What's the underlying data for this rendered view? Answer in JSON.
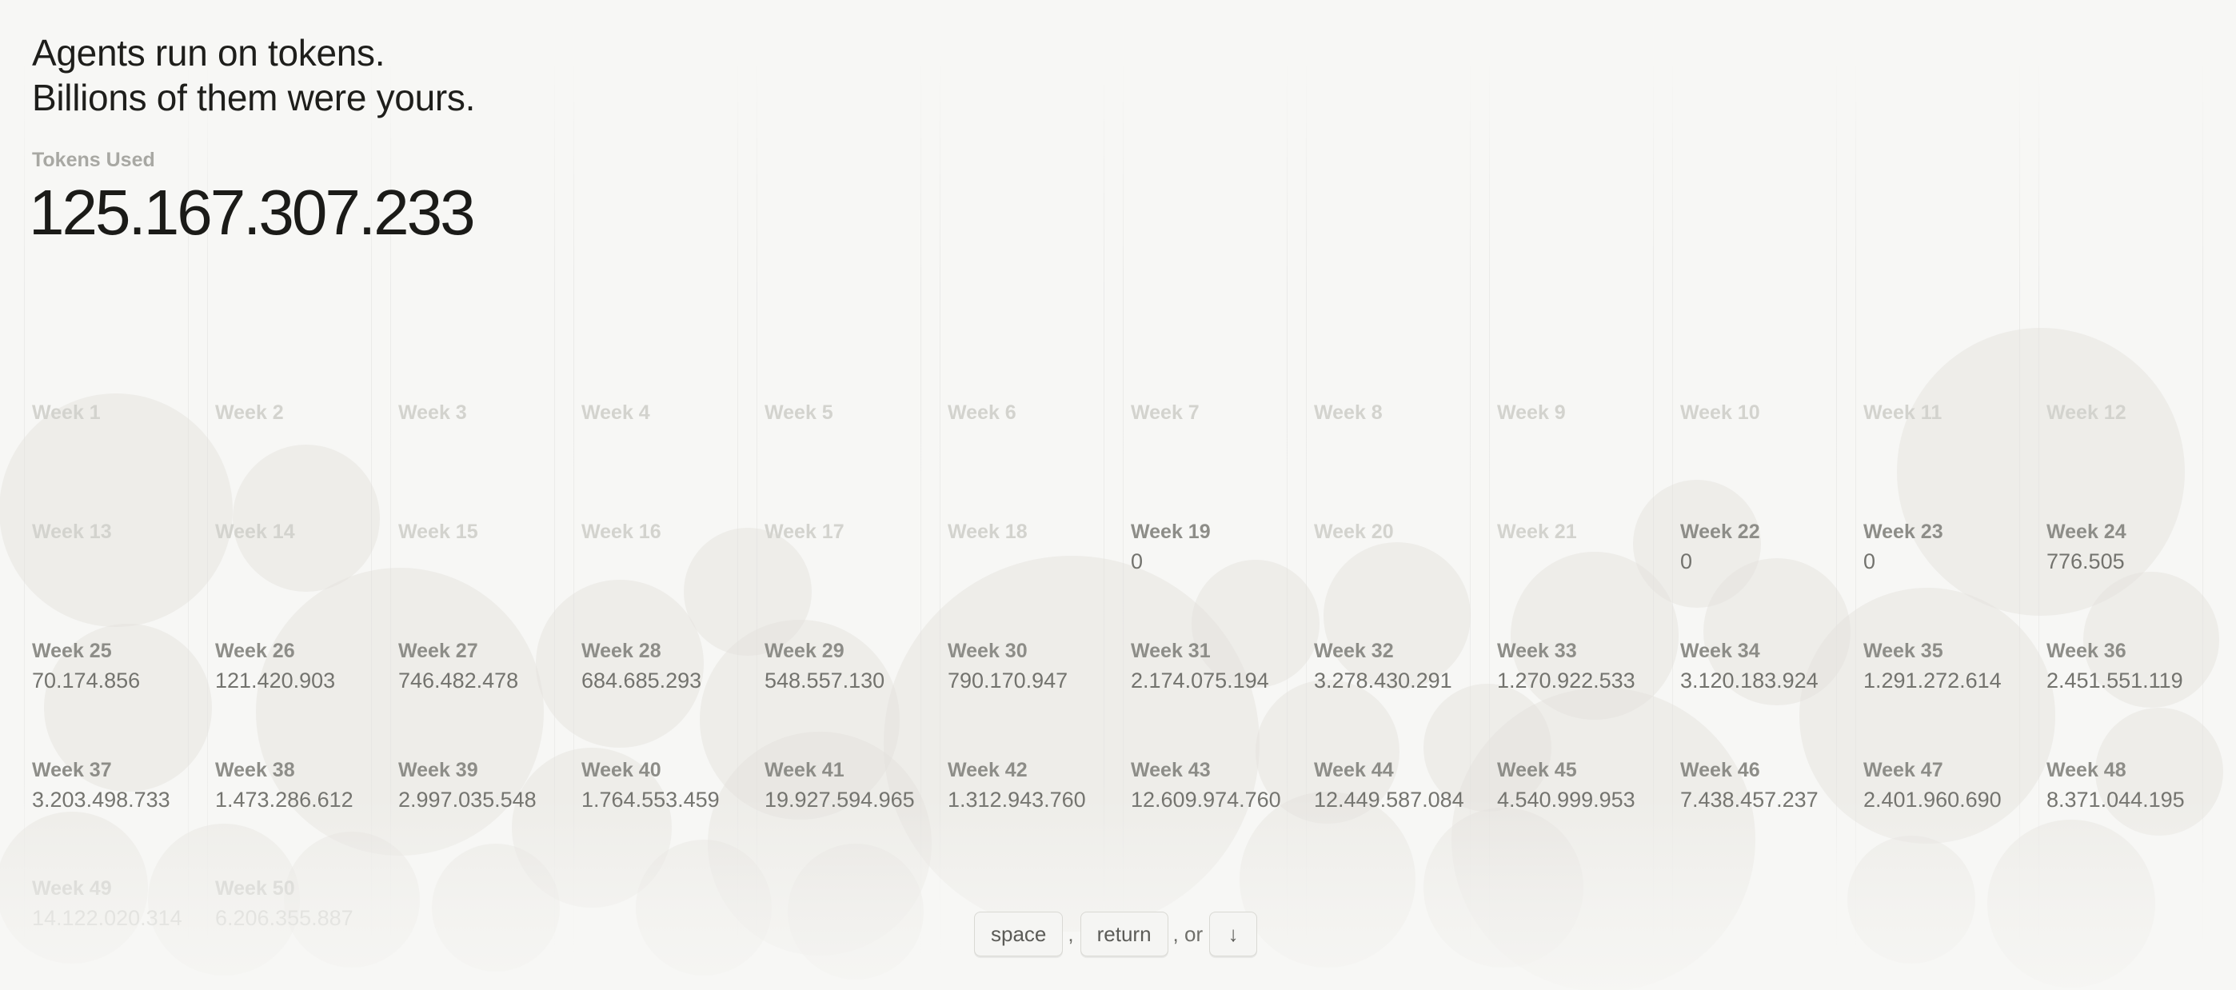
{
  "headline": {
    "line1": "Agents run on tokens.",
    "line2": "Billions of them were yours."
  },
  "tokens": {
    "label": "Tokens Used",
    "value": "125.167.307.233"
  },
  "weeks": [
    {
      "label": "Week 1",
      "value": "",
      "state": "faint"
    },
    {
      "label": "Week 2",
      "value": "",
      "state": "faint"
    },
    {
      "label": "Week 3",
      "value": "",
      "state": "faint"
    },
    {
      "label": "Week 4",
      "value": "",
      "state": "faint"
    },
    {
      "label": "Week 5",
      "value": "",
      "state": "faint"
    },
    {
      "label": "Week 6",
      "value": "",
      "state": "faint"
    },
    {
      "label": "Week 7",
      "value": "",
      "state": "faint"
    },
    {
      "label": "Week 8",
      "value": "",
      "state": "faint"
    },
    {
      "label": "Week 9",
      "value": "",
      "state": "faint"
    },
    {
      "label": "Week 10",
      "value": "",
      "state": "faint"
    },
    {
      "label": "Week 11",
      "value": "",
      "state": "faint"
    },
    {
      "label": "Week 12",
      "value": "",
      "state": "faint"
    },
    {
      "label": "Week 13",
      "value": "",
      "state": "faint"
    },
    {
      "label": "Week 14",
      "value": "",
      "state": "faint"
    },
    {
      "label": "Week 15",
      "value": "",
      "state": "faint"
    },
    {
      "label": "Week 16",
      "value": "",
      "state": "faint"
    },
    {
      "label": "Week 17",
      "value": "",
      "state": "faint"
    },
    {
      "label": "Week 18",
      "value": "",
      "state": "faint"
    },
    {
      "label": "Week 19",
      "value": "0",
      "state": "active"
    },
    {
      "label": "Week 20",
      "value": "",
      "state": "faint"
    },
    {
      "label": "Week 21",
      "value": "",
      "state": "faint"
    },
    {
      "label": "Week 22",
      "value": "0",
      "state": "active"
    },
    {
      "label": "Week 23",
      "value": "0",
      "state": "active"
    },
    {
      "label": "Week 24",
      "value": "776.505",
      "state": "active"
    },
    {
      "label": "Week 25",
      "value": "70.174.856",
      "state": "active"
    },
    {
      "label": "Week 26",
      "value": "121.420.903",
      "state": "active"
    },
    {
      "label": "Week 27",
      "value": "746.482.478",
      "state": "active"
    },
    {
      "label": "Week 28",
      "value": "684.685.293",
      "state": "active"
    },
    {
      "label": "Week 29",
      "value": "548.557.130",
      "state": "active"
    },
    {
      "label": "Week 30",
      "value": "790.170.947",
      "state": "active"
    },
    {
      "label": "Week 31",
      "value": "2.174.075.194",
      "state": "active"
    },
    {
      "label": "Week 32",
      "value": "3.278.430.291",
      "state": "active"
    },
    {
      "label": "Week 33",
      "value": "1.270.922.533",
      "state": "active"
    },
    {
      "label": "Week 34",
      "value": "3.120.183.924",
      "state": "active"
    },
    {
      "label": "Week 35",
      "value": "1.291.272.614",
      "state": "active"
    },
    {
      "label": "Week 36",
      "value": "2.451.551.119",
      "state": "active"
    },
    {
      "label": "Week 37",
      "value": "3.203.498.733",
      "state": "active"
    },
    {
      "label": "Week 38",
      "value": "1.473.286.612",
      "state": "active"
    },
    {
      "label": "Week 39",
      "value": "2.997.035.548",
      "state": "active"
    },
    {
      "label": "Week 40",
      "value": "1.764.553.459",
      "state": "active"
    },
    {
      "label": "Week 41",
      "value": "19.927.594.965",
      "state": "active"
    },
    {
      "label": "Week 42",
      "value": "1.312.943.760",
      "state": "active"
    },
    {
      "label": "Week 43",
      "value": "12.609.974.760",
      "state": "active"
    },
    {
      "label": "Week 44",
      "value": "12.449.587.084",
      "state": "active"
    },
    {
      "label": "Week 45",
      "value": "4.540.999.953",
      "state": "active"
    },
    {
      "label": "Week 46",
      "value": "7.438.457.237",
      "state": "active"
    },
    {
      "label": "Week 47",
      "value": "2.401.960.690",
      "state": "active"
    },
    {
      "label": "Week 48",
      "value": "8.371.044.195",
      "state": "active"
    },
    {
      "label": "Week 49",
      "value": "14.122.020.314",
      "state": "dim"
    },
    {
      "label": "Week 50",
      "value": "6.206.355.887",
      "state": "dim"
    }
  ],
  "nav": {
    "space_label": "space",
    "sep1": ",",
    "return_label": "return",
    "sep2": ", or",
    "arrow_label": "↓"
  }
}
